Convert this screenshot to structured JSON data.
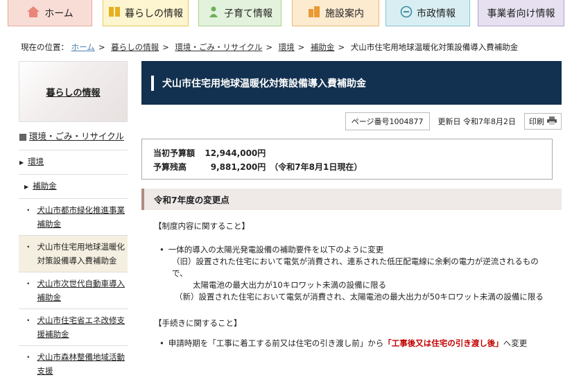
{
  "nav": [
    {
      "label": "ホーム",
      "icon": "home-icon",
      "bg": "#f8ddd6",
      "border": "#e9a89a",
      "icolor": "#e9857a"
    },
    {
      "label": "暮らしの情報",
      "icon": "book-icon",
      "bg": "#fdf5cf",
      "border": "#e8c860",
      "icolor": "#e5b020"
    },
    {
      "label": "子育て情報",
      "icon": "child-icon",
      "bg": "#e3f2dc",
      "border": "#a8d090",
      "icolor": "#6db05a"
    },
    {
      "label": "施設案内",
      "icon": "building-icon",
      "bg": "#fdebd0",
      "border": "#ecb86f",
      "icolor": "#e99a33"
    },
    {
      "label": "市政情報",
      "icon": "city-icon",
      "bg": "#d9eef3",
      "border": "#88c3cf",
      "icolor": "#3a8e9e"
    },
    {
      "label": "事業者向け情報",
      "icon": "business-icon",
      "bg": "#e6e0f0",
      "border": "#b0a0d0",
      "icolor": "#7a68aa"
    }
  ],
  "breadcrumb": {
    "prefix": "現在の位置：",
    "links": [
      "ホーム",
      "暮らしの情報",
      "環境・ごみ・リサイクル",
      "環境",
      "補助金"
    ],
    "current": "犬山市住宅用地球温暖化対策設備導入費補助金"
  },
  "sidebar": {
    "heading": "暮らしの情報",
    "category": "環境・ごみ・リサイクル",
    "sub": "環境",
    "subsub": "補助金",
    "items": [
      "犬山市都市緑化推進事業補助金",
      "犬山市住宅用地球温暖化対策設備導入費補助金",
      "犬山市次世代自動車導入補助金",
      "犬山市住宅省エネ改修支援補助金",
      "犬山市森林整備地域活動支援"
    ]
  },
  "page": {
    "title": "犬山市住宅用地球温暖化対策設備導入費補助金",
    "page_no": "ページ番号1004877",
    "updated": "更新日 令和7年8月2日",
    "print": "印刷"
  },
  "budget": {
    "initial_label": "当初予算額",
    "initial_value": "12,944,000円",
    "remaining_label": "予算残高",
    "remaining_value": "9,881,200円　（令和7年8月1日現在）"
  },
  "section": {
    "heading": "令和7年度の変更点",
    "sys_heading": "【制度内容に関すること】",
    "bullet1": "一体的導入の太陽光発電設備の補助要件を以下のように変更",
    "old1": "（旧）設置された住宅において電気が消費され、連系された低圧配電線に余剰の電力が逆流されるもの",
    "old2": "で、",
    "old3": "太陽電池の最大出力が10キロワット未満の設備に限る",
    "new1": "（新）設置された住宅において電気が消費され、太陽電池の最大出力が50キロワット未満の設備に限る",
    "proc_heading": "【手続きに関すること】",
    "bullet2_pre": "申請時期を「工事に着工する前又は住宅の引き渡し前」から",
    "bullet2_red": "「工事後又は住宅の引き渡し後」",
    "bullet2_post": "へ変更"
  }
}
